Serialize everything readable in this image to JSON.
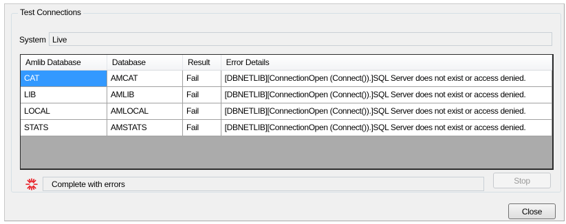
{
  "group": {
    "title": "Test Connections"
  },
  "system": {
    "label": "System",
    "value": "Live"
  },
  "grid": {
    "columns": [
      "Amlib Database",
      "Database",
      "Result",
      "Error Details"
    ],
    "rows": [
      [
        "CAT",
        "AMCAT",
        "Fail",
        "[DBNETLIB][ConnectionOpen (Connect()).]SQL Server does not exist or access denied."
      ],
      [
        "LIB",
        "AMLIB",
        "Fail",
        "[DBNETLIB][ConnectionOpen (Connect()).]SQL Server does not exist or access denied."
      ],
      [
        "LOCAL",
        "AMLOCAL",
        "Fail",
        "[DBNETLIB][ConnectionOpen (Connect()).]SQL Server does not exist or access denied."
      ],
      [
        "STATS",
        "AMSTATS",
        "Fail",
        "[DBNETLIB][ConnectionOpen (Connect()).]SQL Server does not exist or access denied."
      ]
    ],
    "selected_row": 0
  },
  "status": {
    "icon": "spinner-icon",
    "text": "Complete with errors"
  },
  "buttons": {
    "stop": "Stop",
    "close": "Close"
  },
  "colors": {
    "selection": "#3399ff",
    "grid_empty": "#ababab",
    "spinner": "#e8141c"
  }
}
